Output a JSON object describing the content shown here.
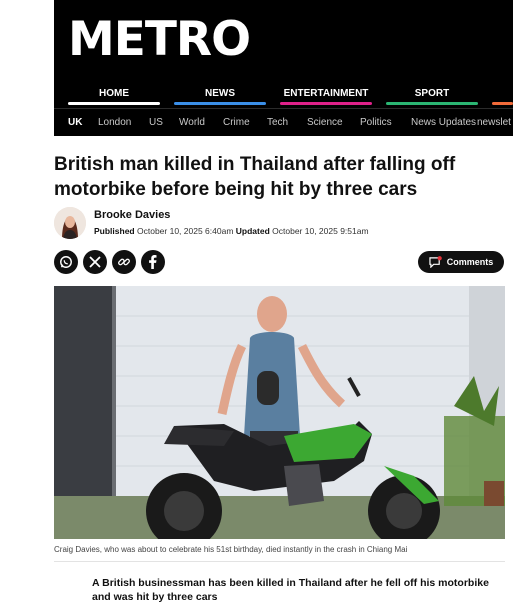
{
  "site": {
    "logo": "METRO"
  },
  "main_nav": [
    {
      "label": "HOME",
      "color": "#ffffff"
    },
    {
      "label": "NEWS",
      "color": "#3b8fe8"
    },
    {
      "label": "ENTERTAINMENT",
      "color": "#e0218a"
    },
    {
      "label": "SPORT",
      "color": "#2bb673"
    },
    {
      "label": "",
      "color": "#f26b3a"
    }
  ],
  "sub_nav": [
    "UK",
    "London",
    "US",
    "World",
    "Crime",
    "Tech",
    "Science",
    "Politics",
    "News Updates",
    "newslet"
  ],
  "article": {
    "headline": "British man killed in Thailand after falling off motorbike before being hit by three cars",
    "author": "Brooke Davies",
    "published_label": "Published",
    "published": "October 10, 2025 6:40am",
    "updated_label": "Updated",
    "updated": "October 10, 2025 9:51am",
    "comments_label": "Comments",
    "caption": "Craig Davies, who was about to celebrate his 51st birthday, died instantly in the crash in Chiang Mai",
    "lede": "A British businessman has been killed in Thailand after he fell off his motorbike and was hit by three cars"
  },
  "share_icons": [
    "whatsapp-icon",
    "x-icon",
    "link-icon",
    "facebook-icon"
  ]
}
